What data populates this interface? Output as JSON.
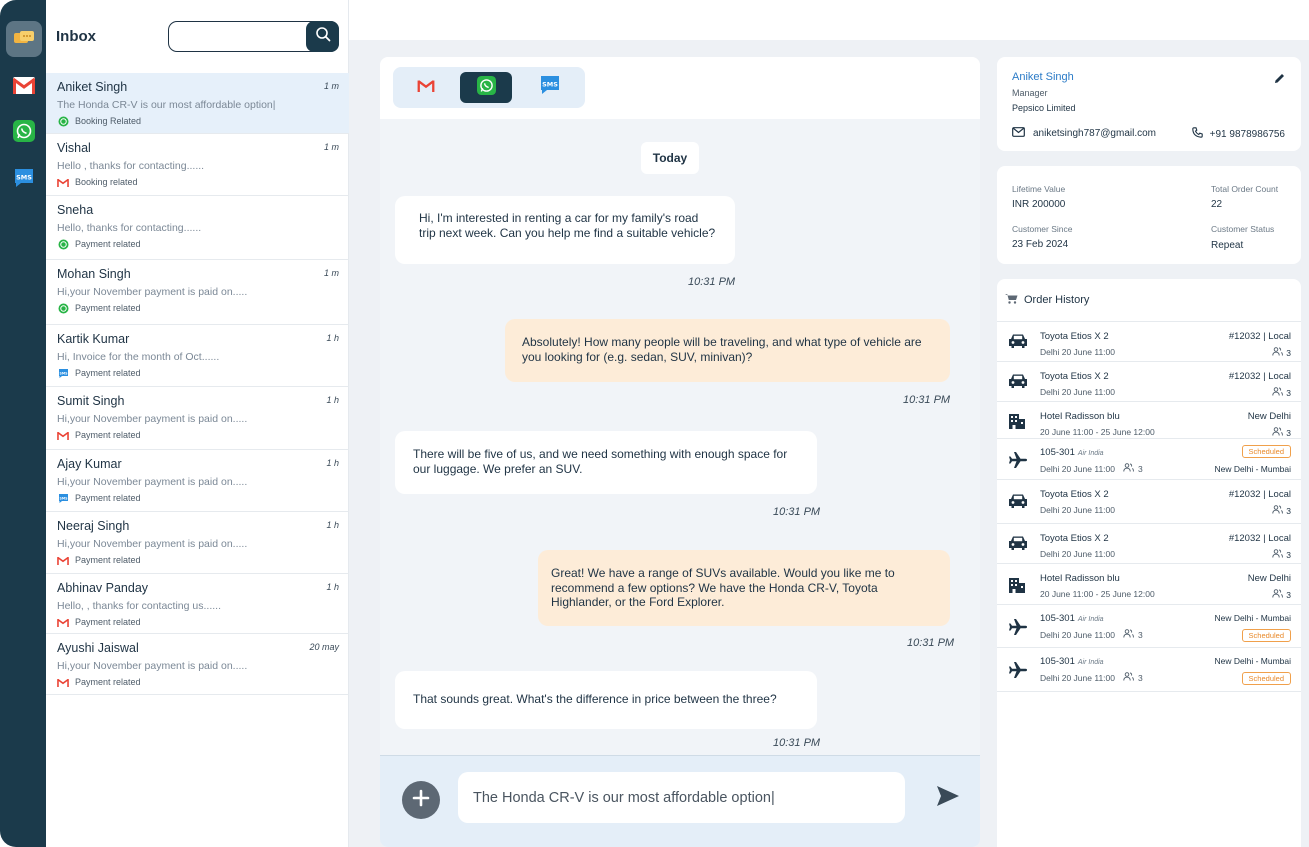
{
  "rail": {
    "items": [
      {
        "icon": "chat-bubbles-icon",
        "active": true
      },
      {
        "icon": "gmail-icon",
        "active": false
      },
      {
        "icon": "whatsapp-icon",
        "active": false
      },
      {
        "icon": "sms-icon",
        "active": false
      }
    ]
  },
  "inbox": {
    "title": "Inbox",
    "search_placeholder": "",
    "conversations": [
      {
        "name": "Aniket Singh",
        "time": "1 m",
        "preview": "The Honda CR-V is our most affordable option|",
        "channel": "whatsapp",
        "tag": "Booking Related",
        "active": true
      },
      {
        "name": "Vishal",
        "time": "1 m",
        "preview": "Hello , thanks for contacting......",
        "channel": "gmail",
        "tag": "Booking related",
        "active": false
      },
      {
        "name": "Sneha",
        "time": "",
        "preview": "Hello, thanks for contacting......",
        "channel": "whatsapp",
        "tag": "Payment related",
        "active": false
      },
      {
        "name": "Mohan Singh",
        "time": "1 m",
        "preview": "Hi,your November payment is paid  on.....",
        "channel": "whatsapp",
        "tag": "Payment related",
        "active": false
      },
      {
        "name": "Kartik Kumar",
        "time": "1 h",
        "preview": "Hi, Invoice for the month of Oct......",
        "channel": "sms",
        "tag": "Payment related",
        "active": false
      },
      {
        "name": "Sumit Singh",
        "time": "1 h",
        "preview": "Hi,your November payment is paid  on.....",
        "channel": "gmail",
        "tag": "Payment related",
        "active": false
      },
      {
        "name": "Ajay Kumar",
        "time": "1 h",
        "preview": "Hi,your November payment is paid  on.....",
        "channel": "sms",
        "tag": "Payment related",
        "active": false
      },
      {
        "name": "Neeraj Singh",
        "time": "1 h",
        "preview": "Hi,your November payment is paid  on.....",
        "channel": "gmail",
        "tag": "Payment related",
        "active": false
      },
      {
        "name": "Abhinav Panday",
        "time": "1 h",
        "preview": "Hello, , thanks for contacting us......",
        "channel": "gmail",
        "tag": "Payment related",
        "active": false
      },
      {
        "name": "Ayushi Jaiswal",
        "time": "20 may",
        "preview": "Hi,your November payment is paid  on.....",
        "channel": "gmail",
        "tag": "Payment related",
        "active": false
      }
    ]
  },
  "chat": {
    "channel_tabs": [
      {
        "icon": "gmail-icon",
        "active": false
      },
      {
        "icon": "whatsapp-icon",
        "active": true
      },
      {
        "icon": "sms-icon",
        "active": false
      }
    ],
    "date_divider": "Today",
    "messages": [
      {
        "direction": "in",
        "text": "Hi, I'm interested in renting a car for my family's road trip next week. Can you help me find a suitable vehicle?",
        "time": "10:31 PM"
      },
      {
        "direction": "out",
        "text": "Absolutely! How many people will be traveling, and what type of vehicle are you looking for (e.g. sedan, SUV, minivan)?",
        "time": "10:31 PM"
      },
      {
        "direction": "in",
        "text": "There will be five of us, and we need something with enough space for our luggage. We prefer an SUV.",
        "time": "10:31 PM"
      },
      {
        "direction": "out",
        "text": "Great! We have a range of SUVs available. Would you like me to recommend a few options? We have the Honda CR-V, Toyota Highlander, or the Ford Explorer.",
        "time": "10:31 PM"
      },
      {
        "direction": "in",
        "text": "That sounds great. What's the difference in price between the three?",
        "time": "10:31 PM"
      }
    ],
    "composer_value": "The Honda CR-V is our most affordable option|"
  },
  "contact": {
    "name": "Aniket Singh",
    "role": "Manager",
    "company": "Pepsico Limited",
    "email": "aniketsingh787@gmail.com",
    "phone": "+91 9878986756"
  },
  "stats": {
    "lifetime_value_label": "Lifetime Value",
    "lifetime_value": "INR 200000",
    "total_orders_label": "Total Order Count",
    "total_orders": "22",
    "customer_since_label": "Customer Since",
    "customer_since": "23 Feb 2024",
    "status_label": "Customer Status",
    "status": "Repeat"
  },
  "order_history": {
    "title": "Order History",
    "items": [
      {
        "type": "car",
        "name": "Toyota Etios X 2",
        "sub": "Delhi 20 June 11:00",
        "right": "#12032 | Local",
        "pax": "3"
      },
      {
        "type": "car",
        "name": "Toyota Etios X 2",
        "sub": "Delhi 20 June 11:00",
        "right": "#12032 | Local",
        "pax": "3"
      },
      {
        "type": "hotel",
        "name": "Hotel Radisson blu",
        "sub": "20 June 11:00 - 25 June 12:00",
        "right": "New Delhi",
        "pax": "3"
      },
      {
        "type": "flight",
        "name": "105-301",
        "airline": "Air India",
        "sub": "Delhi 20 June 11:00",
        "pax": "3",
        "badge": "Scheduled",
        "route": "New Delhi - Mumbai"
      },
      {
        "type": "car",
        "name": "Toyota Etios X 2",
        "sub": "Delhi 20 June 11:00",
        "right": "#12032 | Local",
        "pax": "3"
      },
      {
        "type": "car",
        "name": "Toyota Etios X 2",
        "sub": "Delhi 20 June 11:00",
        "right": "#12032 | Local",
        "pax": "3"
      },
      {
        "type": "hotel",
        "name": "Hotel Radisson blu",
        "sub": "20 June 11:00 - 25 June 12:00",
        "right": "New Delhi",
        "pax": "3"
      },
      {
        "type": "flight",
        "name": "105-301",
        "airline": "Air India",
        "sub": "Delhi 20 June 11:00",
        "pax": "3",
        "badge": "Scheduled",
        "route": "New Delhi - Mumbai"
      },
      {
        "type": "flight",
        "name": "105-301",
        "airline": "Air India",
        "sub": "Delhi 20 June 11:00",
        "pax": "3",
        "badge": "Scheduled",
        "route": "New Delhi - Mumbai"
      }
    ]
  }
}
